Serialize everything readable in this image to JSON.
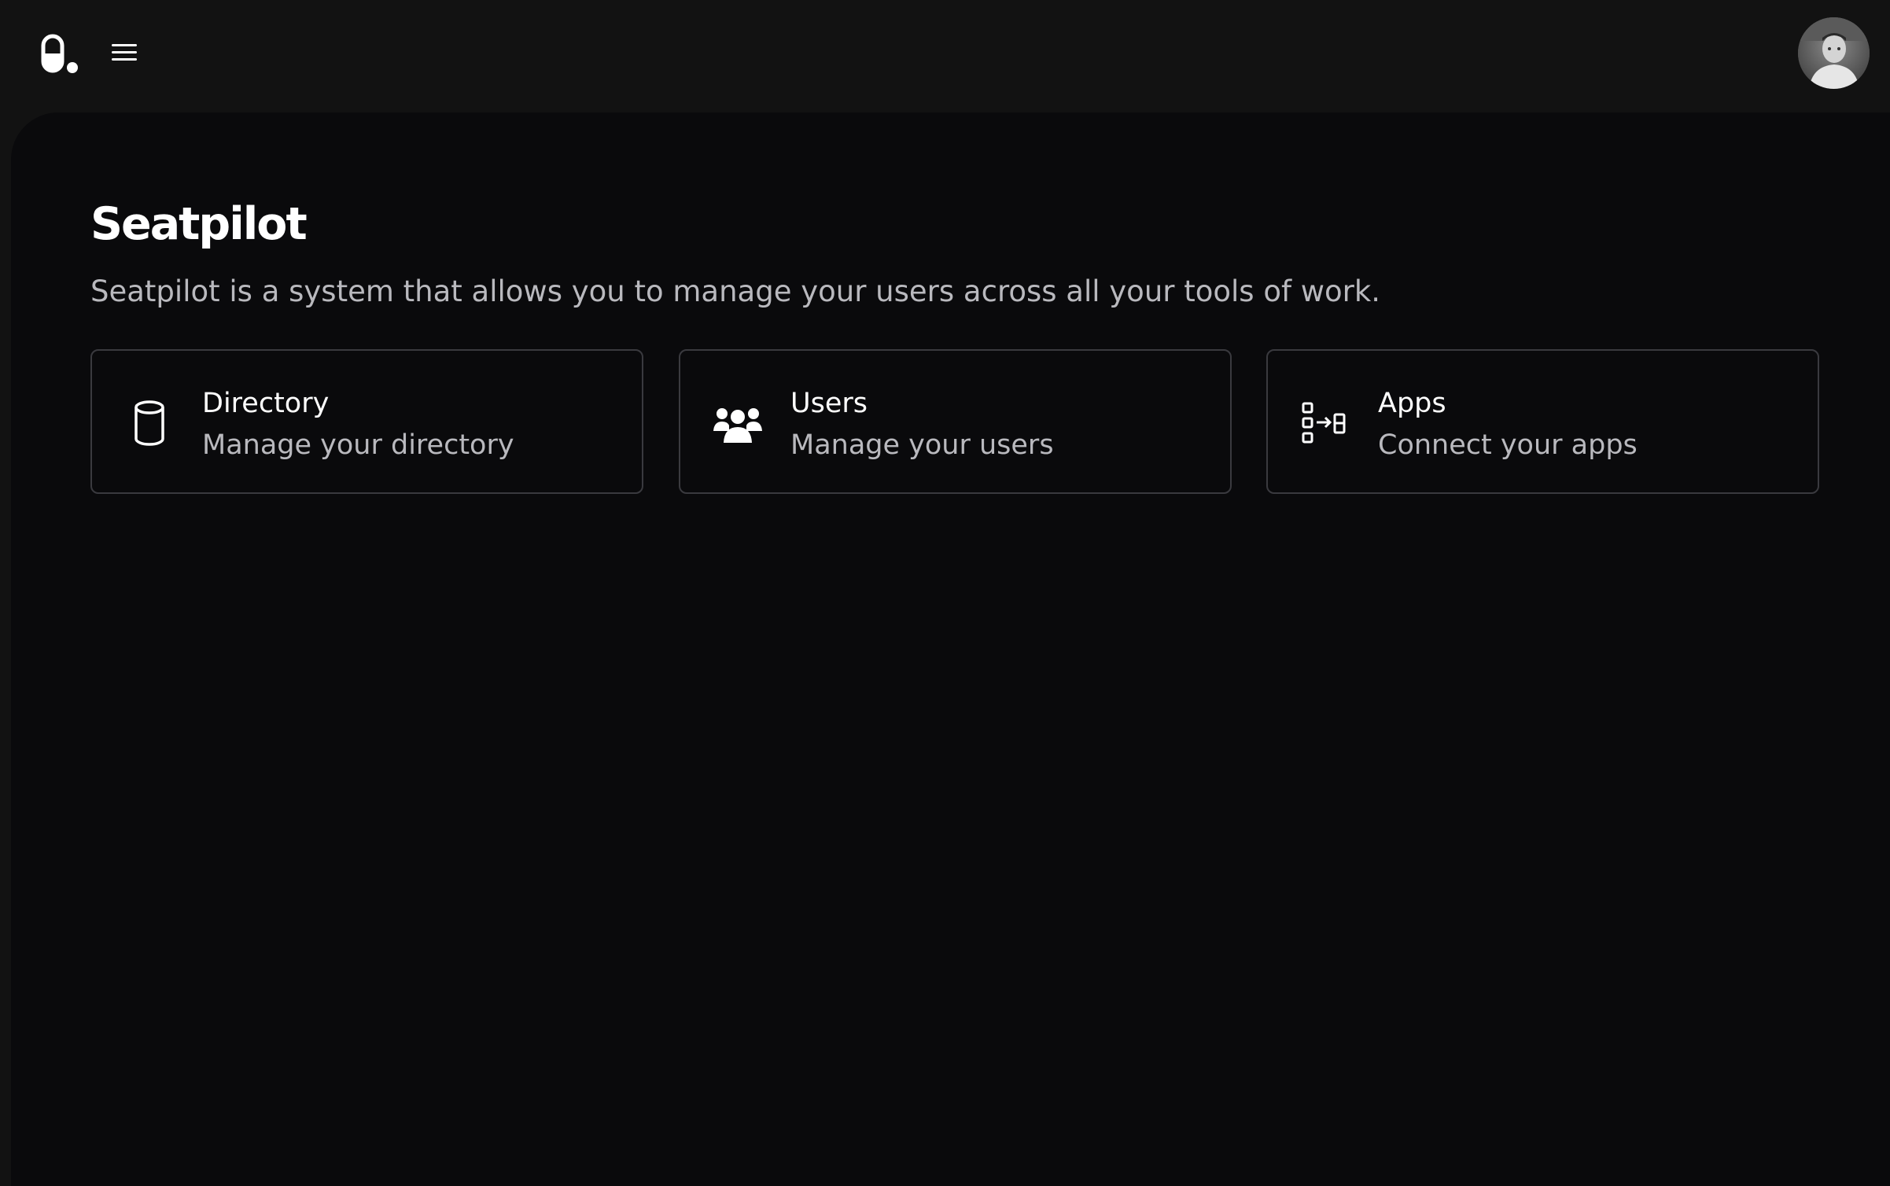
{
  "header": {
    "logo_icon": "seatpilot-logo-icon",
    "menu_icon": "hamburger-menu-icon",
    "avatar_icon": "user-avatar"
  },
  "main": {
    "title": "Seatpilot",
    "description": "Seatpilot is a system that allows you to manage your users across all your tools of work.",
    "cards": [
      {
        "icon": "database-cylinder-icon",
        "title": "Directory",
        "subtitle": "Manage your directory"
      },
      {
        "icon": "users-group-icon",
        "title": "Users",
        "subtitle": "Manage your users"
      },
      {
        "icon": "apps-connect-icon",
        "title": "Apps",
        "subtitle": "Connect your apps"
      }
    ]
  },
  "colors": {
    "background": "#0a0a0c",
    "topbar": "#121212",
    "card_border": "#3a3a3f",
    "text_primary": "#ffffff",
    "text_secondary": "#b9b9be"
  }
}
